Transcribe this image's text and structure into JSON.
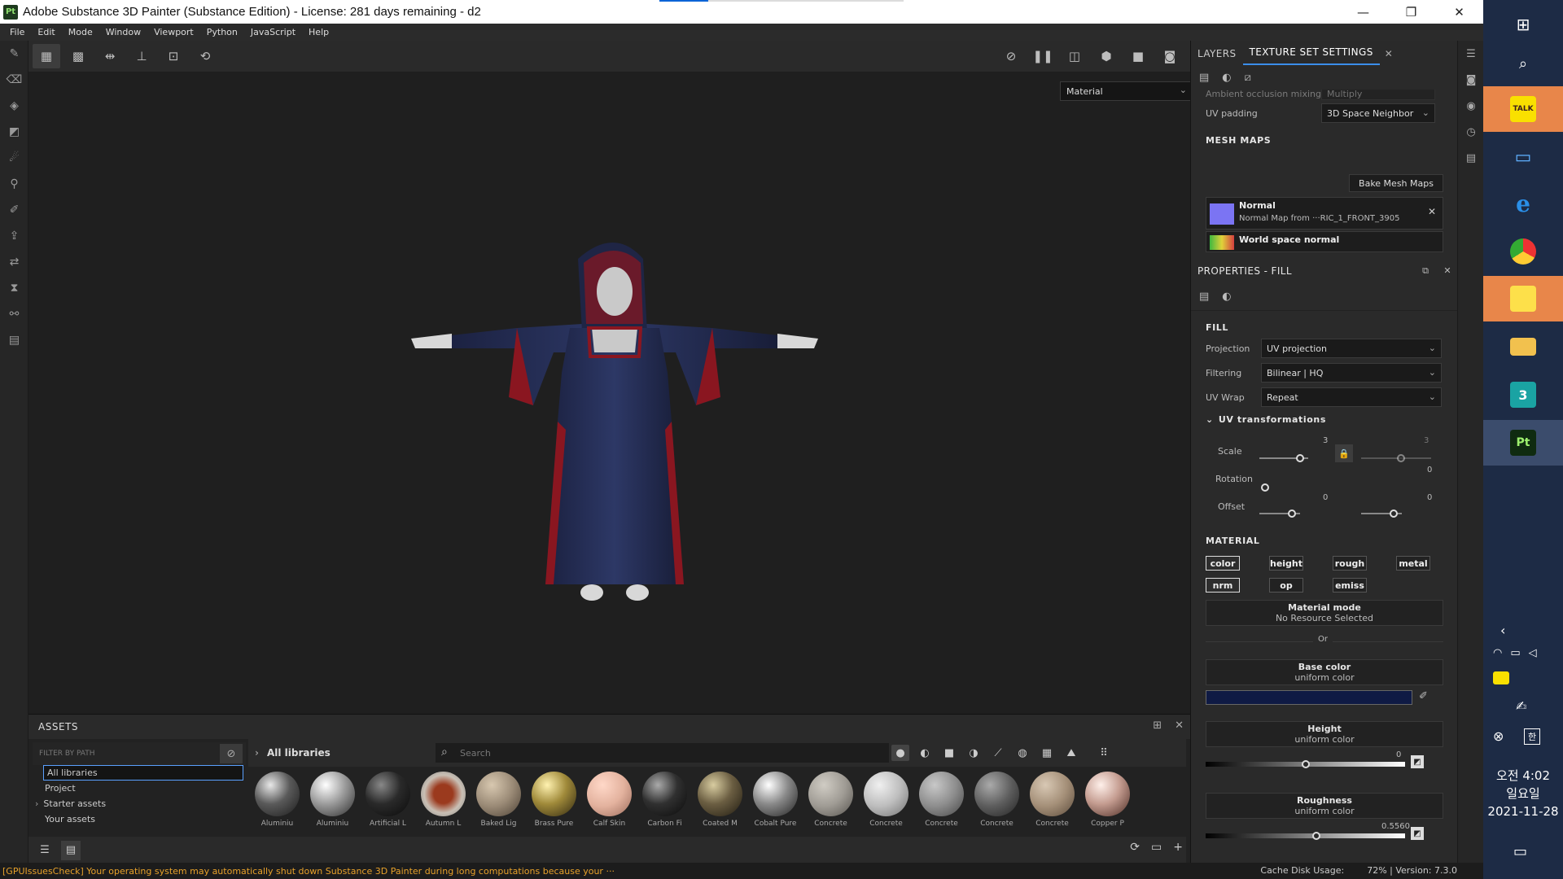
{
  "window": {
    "title": "Adobe Substance 3D Painter (Substance Edition) - License: 281 days remaining - d2",
    "app_icon": "Pt",
    "minimize": "—",
    "restore": "❐",
    "close": "✕"
  },
  "menu": [
    "File",
    "Edit",
    "Mode",
    "Window",
    "Viewport",
    "Python",
    "JavaScript",
    "Help"
  ],
  "viewport": {
    "display_mode": "Material"
  },
  "assets": {
    "title": "ASSETS",
    "filter_placeholder": "FILTER BY PATH",
    "libraries": [
      "All libraries",
      "Project",
      "Starter assets",
      "Your assets"
    ],
    "breadcrumb": "All libraries",
    "search_placeholder": "Search",
    "items": [
      {
        "label": "Aluminiu",
        "color": "#5a5a5a"
      },
      {
        "label": "Aluminiu",
        "color": "#9c9c9c"
      },
      {
        "label": "Artificial L",
        "color": "#2a2a2a"
      },
      {
        "label": "Autumn L",
        "color": "#c9c0b5"
      },
      {
        "label": "Baked Lig",
        "color": "#9a8a76"
      },
      {
        "label": "Brass Pure",
        "color": "#a08a3a"
      },
      {
        "label": "Calf Skin",
        "color": "#e3b29e"
      },
      {
        "label": "Carbon Fi",
        "color": "#303030"
      },
      {
        "label": "Coated M",
        "color": "#6b5e42"
      },
      {
        "label": "Cobalt Pure",
        "color": "#8a8a8a"
      },
      {
        "label": "Concrete",
        "color": "#9f9b94"
      },
      {
        "label": "Concrete",
        "color": "#bdbdbd"
      },
      {
        "label": "Concrete",
        "color": "#8d8d8d"
      },
      {
        "label": "Concrete",
        "color": "#5d5d5d"
      },
      {
        "label": "Concrete",
        "color": "#a48f78"
      },
      {
        "label": "Copper P",
        "color": "#c49c90"
      }
    ]
  },
  "status": {
    "warning": "[GPUIssuesCheck] Your operating system may automatically shut down Substance 3D Painter during long computations because your ···",
    "cache": "Cache Disk Usage:",
    "cache_pct": "72%",
    "version": "| Version: 7.3.0"
  },
  "texture_set": {
    "tabs": [
      "LAYERS",
      "TEXTURE SET SETTINGS"
    ],
    "ao_label": "Ambient occlusion mixing",
    "ao_value": "Multiply",
    "uv_padding_label": "UV padding",
    "uv_padding_value": "3D Space Neighbor",
    "mesh_maps_title": "MESH MAPS",
    "bake_button": "Bake Mesh Maps",
    "map1_title": "Normal",
    "map1_sub": "Normal Map from ···RIC_1_FRONT_3905",
    "map2_title": "World space normal"
  },
  "properties": {
    "title": "PROPERTIES - FILL",
    "fill_title": "FILL",
    "projection_label": "Projection",
    "projection_value": "UV projection",
    "filtering_label": "Filtering",
    "filtering_value": "Bilinear | HQ",
    "uvwrap_label": "UV Wrap",
    "uvwrap_value": "Repeat",
    "uv_transform_title": "UV transformations",
    "scale_label": "Scale",
    "scale_value": "3",
    "scale_value2": "3",
    "rotation_label": "Rotation",
    "rotation_value": "0",
    "offset_label": "Offset",
    "offset_value1": "0",
    "offset_value2": "0",
    "material_title": "MATERIAL",
    "channels": [
      "color",
      "height",
      "rough",
      "metal",
      "nrm",
      "op",
      "emiss"
    ],
    "material_mode_title": "Material mode",
    "material_mode_sub": "No Resource Selected",
    "or_text": "Or",
    "base_color_title": "Base color",
    "base_color_sub": "uniform color",
    "base_color_swatch": "#0f1a44",
    "height_title": "Height",
    "height_sub": "uniform color",
    "height_value": "0",
    "height_level": 0.5,
    "roughness_title": "Roughness",
    "roughness_sub": "uniform color",
    "roughness_value": "0.5560",
    "roughness_level": 0.556
  },
  "taskbar": {
    "time": "오전 4:02",
    "day": "일요일",
    "date": "2021-11-28",
    "talk_label": "TALK",
    "pt_label": "Pt",
    "three_label": "3",
    "ime_label": "한"
  }
}
